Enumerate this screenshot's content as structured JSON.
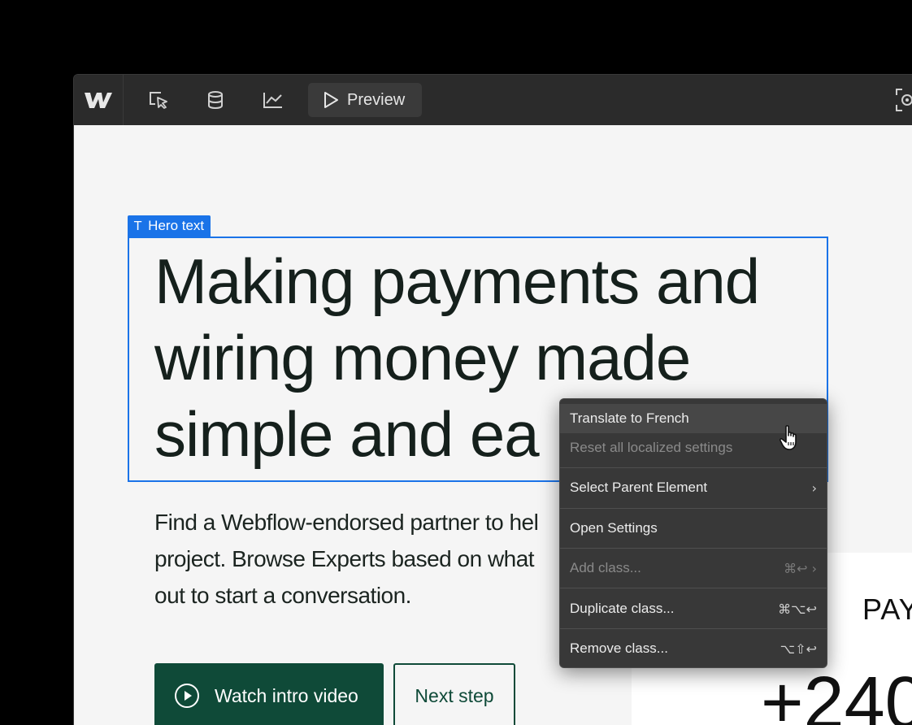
{
  "toolbar": {
    "logo_icon": "webflow-logo",
    "tools": [
      "select-element-icon",
      "database-icon",
      "analytics-icon"
    ],
    "preview_label": "Preview",
    "preview_icon": "play-icon",
    "capture_icon": "screenshot-target-icon"
  },
  "canvas": {
    "selection_tag": "Hero text",
    "hero_line1": "Making payments and",
    "hero_line2": "wiring money made",
    "hero_line3": "simple and ea",
    "sub_line1": "Find a Webflow-endorsed partner to hel",
    "sub_line2": "project. Browse Experts based on what",
    "sub_line3": "out to start a conversation.",
    "primary_button": "Watch intro video",
    "secondary_button": "Next step",
    "pay_text": "PAY",
    "big_number": "+240"
  },
  "context_menu": {
    "translate": "Translate to French",
    "reset": "Reset all localized settings",
    "select_parent": "Select Parent Element",
    "select_parent_chevron": "›",
    "open_settings": "Open Settings",
    "add_class": "Add class...",
    "add_class_shortcut": "⌘↩ ›",
    "duplicate_class": "Duplicate class...",
    "duplicate_shortcut": "⌘⌥↩",
    "remove_class": "Remove class...",
    "remove_shortcut": "⌥⇧↩"
  },
  "colors": {
    "selection_blue": "#1a73e8",
    "brand_green": "#0f4a38",
    "menu_bg": "#383838"
  }
}
